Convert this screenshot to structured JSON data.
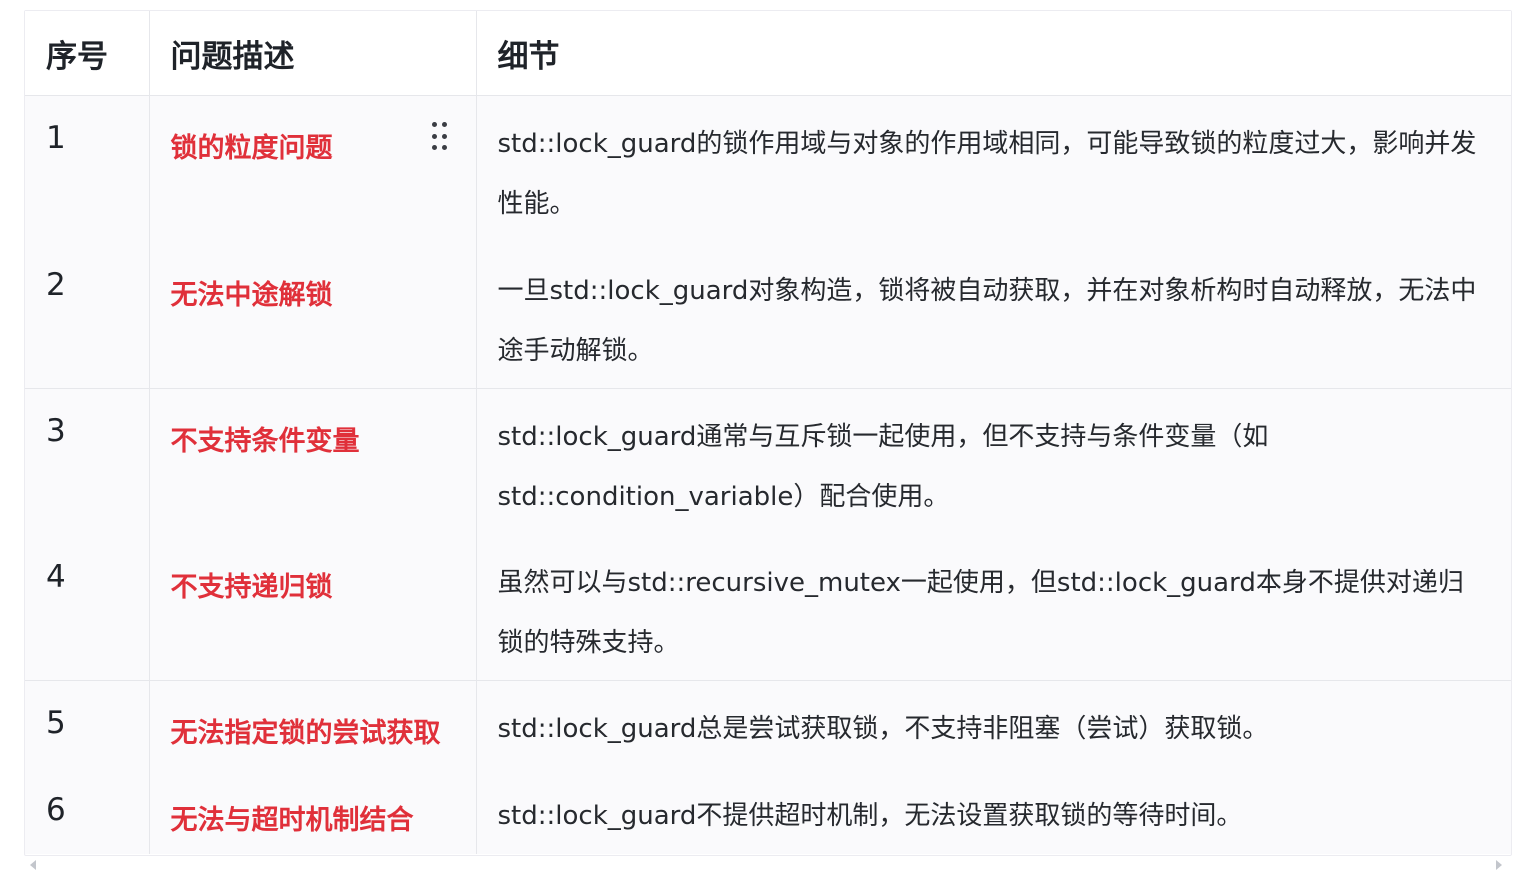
{
  "table": {
    "headers": [
      "序号",
      "问题描述",
      "细节"
    ],
    "rows": [
      {
        "num": "1",
        "title": "锁的粒度问题",
        "detail": "std::lock_guard的锁作用域与对象的作用域相同，可能导致锁的粒度过大，影响并发性能。"
      },
      {
        "num": "2",
        "title": "无法中途解锁",
        "detail": "一旦std::lock_guard对象构造，锁将被自动获取，并在对象析构时自动释放，无法中途手动解锁。"
      },
      {
        "num": "3",
        "title": "不支持条件变量",
        "detail": "std::lock_guard通常与互斥锁一起使用，但不支持与条件变量（如std::condition_variable）配合使用。"
      },
      {
        "num": "4",
        "title": "不支持递归锁",
        "detail": "虽然可以与std::recursive_mutex一起使用，但std::lock_guard本身不提供对递归锁的特殊支持。"
      },
      {
        "num": "5",
        "title": "无法指定锁的尝试获取",
        "detail": "std::lock_guard总是尝试获取锁，不支持非阻塞（尝试）获取锁。"
      },
      {
        "num": "6",
        "title": "无法与超时机制结合",
        "detail": "std::lock_guard不提供超时机制，无法设置获取锁的等待时间。"
      }
    ]
  },
  "icons": {
    "drag_handle": "drag-handle-icon",
    "scroll_left": "scroll-left-arrow-icon",
    "scroll_right": "scroll-right-arrow-icon"
  },
  "colors": {
    "title_text": "#e0303a",
    "header_text": "#1f2329",
    "body_background": "#fafafc",
    "border": "#e6e7eb"
  }
}
